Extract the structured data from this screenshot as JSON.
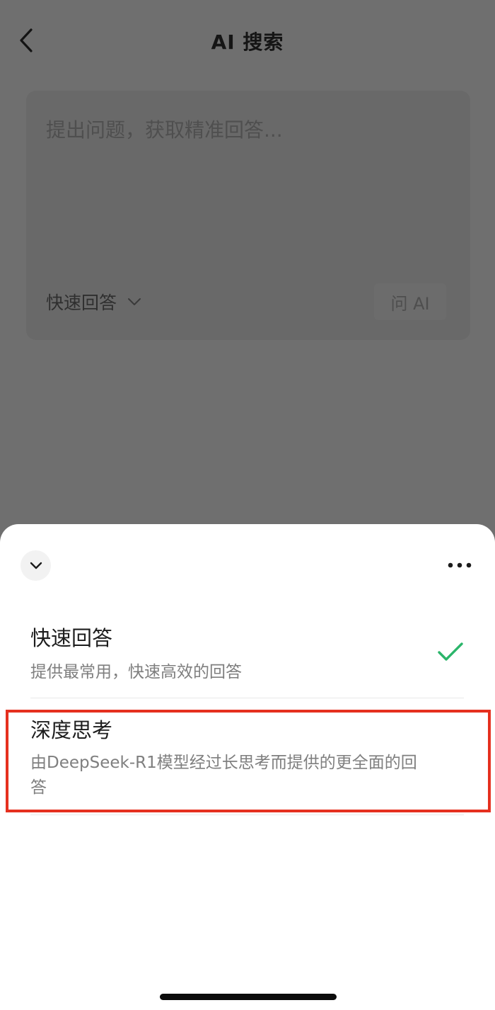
{
  "header": {
    "title": "AI 搜索"
  },
  "search": {
    "placeholder": "提出问题，获取精准回答...",
    "mode_label": "快速回答",
    "ask_label": "问 AI"
  },
  "sheet": {
    "options": [
      {
        "title": "快速回答",
        "description": "提供最常用，快速高效的回答",
        "selected": true
      },
      {
        "title": "深度思考",
        "description": "由DeepSeek-R1模型经过长思考而提供的更全面的回答",
        "selected": false
      }
    ],
    "check_icon": "checkmark-icon"
  },
  "colors": {
    "check": "#2bb56a",
    "highlight": "#e5301f",
    "overlay": "#6f6f6f"
  }
}
